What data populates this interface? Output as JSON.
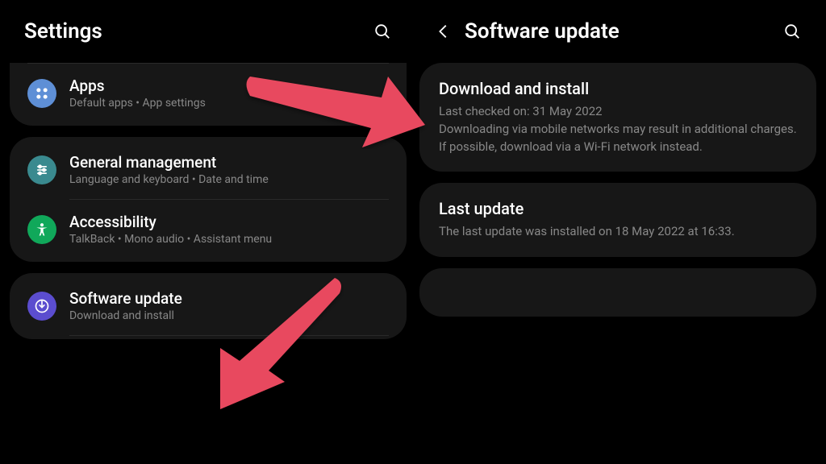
{
  "left": {
    "title": "Settings",
    "apps": {
      "title": "Apps",
      "subtitle": "Default apps  •  App settings"
    },
    "general": {
      "title": "General management",
      "subtitle": "Language and keyboard  •  Date and time"
    },
    "accessibility": {
      "title": "Accessibility",
      "subtitle": "TalkBack  •  Mono audio  •  Assistant menu"
    },
    "software": {
      "title": "Software update",
      "subtitle": "Download and install"
    }
  },
  "right": {
    "title": "Software update",
    "download": {
      "title": "Download and install",
      "body": "Last checked on: 31 May 2022\nDownloading via mobile networks may result in additional charges. If possible, download via a Wi-Fi network instead."
    },
    "last": {
      "title": "Last update",
      "body": "The last update was installed on 18 May 2022 at 16:33."
    }
  }
}
